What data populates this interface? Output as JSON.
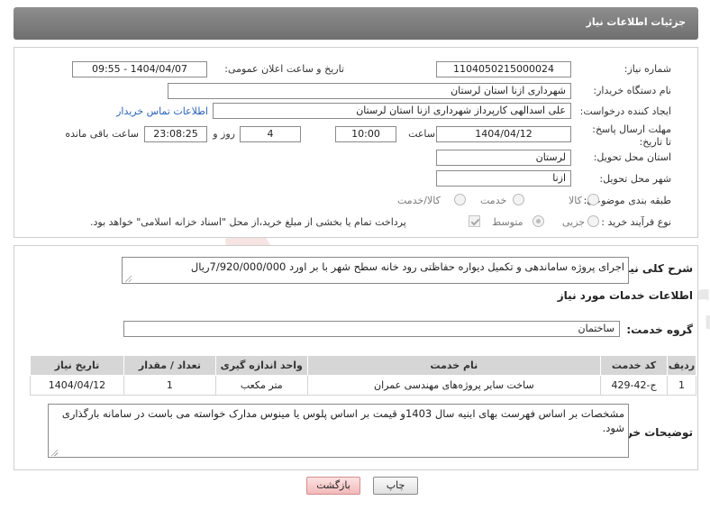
{
  "header": {
    "title": "جزئیات اطلاعات نیاز"
  },
  "form": {
    "need_number_label": "شماره نیاز:",
    "need_number": "1104050215000024",
    "announce_label": "تاریخ و ساعت اعلان عمومی:",
    "announce_value": "1404/04/07 - 09:55",
    "buyer_label": "نام دستگاه خریدار:",
    "buyer_value": "شهرداری ازنا استان لرستان",
    "creator_label": "ایجاد کننده درخواست:",
    "creator_value": "علی اسدالهی کارپرداز شهرداری ازنا استان لرستان",
    "contact_link": "اطلاعات تماس خریدار",
    "deadline_label": "مهلت ارسال پاسخ: تا تاریخ:",
    "deadline_date": "1404/04/12",
    "time_label": "ساعت",
    "deadline_time": "10:00",
    "days_value": "4",
    "days_label": "روز و",
    "remaining_time": "23:08:25",
    "remaining_label": "ساعت باقی مانده",
    "province_label": "استان محل تحویل:",
    "province_value": "لرستان",
    "city_label": "شهر محل تحویل:",
    "city_value": "ازنا",
    "category_label": "طبقه بندی موضوعی:",
    "category_options": [
      "کالا",
      "خدمت",
      "کالا/خدمت"
    ],
    "process_label": "نوع فرآیند خرید :",
    "process_options": [
      "جزیی",
      "متوسط"
    ],
    "payment_note": "پرداخت تمام یا بخشی از مبلغ خرید،از محل \"اسناد خزانه اسلامی\" خواهد بود."
  },
  "details": {
    "summary_label": "شرح کلی نیاز:",
    "summary_value": "اجرای پروژه ساماندهی و تکمیل دیواره حفاظتی رود خانه سطح شهر با بر اورد 7/920/000/000ریال",
    "services_heading": "اطلاعات خدمات مورد نیاز",
    "service_group_label": "گروه خدمت:",
    "service_group_value": "ساختمان",
    "table": {
      "headers": [
        "ردیف",
        "کد خدمت",
        "نام خدمت",
        "واحد اندازه گیری",
        "تعداد / مقدار",
        "تاریخ نیاز"
      ],
      "rows": [
        [
          "1",
          "ج-42-429",
          "ساخت سایر پروژه‌های مهندسی عمران",
          "متر مکعب",
          "1",
          "1404/04/12"
        ]
      ]
    },
    "buyer_notes_label": "توضیحات خریدار:",
    "buyer_notes_value": "مشخصات بر اساس فهرست بهای ابنیه سال 1403و قیمت بر اساس پلوس یا مینوس مدارک خواسته می باست در سامانه بارگذاری شود."
  },
  "buttons": {
    "print": "چاپ",
    "back": "بازگشت"
  },
  "watermark": {
    "text": "AriaTender.neT"
  },
  "colors": {
    "header": "#7d7d7d",
    "link": "#2a63b8",
    "table_header": "#d6d6d6"
  }
}
